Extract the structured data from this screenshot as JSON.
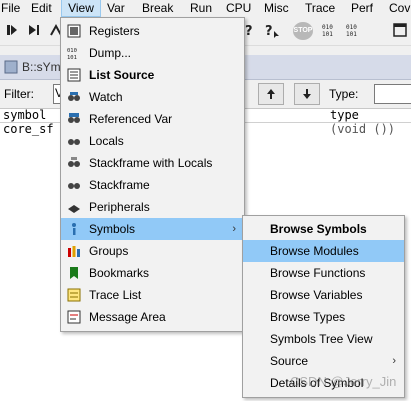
{
  "menubar": {
    "items": [
      "File",
      "Edit",
      "View",
      "Var",
      "Break",
      "Run",
      "CPU",
      "Misc",
      "Trace",
      "Perf",
      "Cov"
    ]
  },
  "toolbar": {
    "stop_label": "STOP"
  },
  "window": {
    "title": "B::sYm",
    "filter_label": "Filter:",
    "filter_value": "V",
    "type_label": "Type:",
    "columns": [
      "symbol",
      "type"
    ],
    "rows": [
      {
        "symbol": "core_sf",
        "type": "(void ())"
      }
    ]
  },
  "view_menu": {
    "items": [
      {
        "label": "Registers",
        "icon": "registers-icon"
      },
      {
        "label": "Dump...",
        "icon": "dump-icon"
      },
      {
        "label": "List Source",
        "icon": "list-source-icon",
        "bold": true
      },
      {
        "label": "Watch",
        "icon": "watch-icon"
      },
      {
        "label": "Referenced Var",
        "icon": "referenced-var-icon"
      },
      {
        "label": "Locals",
        "icon": "locals-icon"
      },
      {
        "label": "Stackframe with Locals",
        "icon": "stackframe-locals-icon"
      },
      {
        "label": "Stackframe",
        "icon": "stackframe-icon"
      },
      {
        "label": "Peripherals",
        "icon": "peripherals-icon"
      },
      {
        "label": "Symbols",
        "icon": "symbols-icon",
        "submenu": true
      },
      {
        "label": "Groups",
        "icon": "groups-icon"
      },
      {
        "label": "Bookmarks",
        "icon": "bookmark-icon"
      },
      {
        "label": "Trace List",
        "icon": "trace-list-icon"
      },
      {
        "label": "Message Area",
        "icon": "message-area-icon"
      }
    ]
  },
  "symbols_menu": {
    "items": [
      {
        "label": "Browse Symbols",
        "bold": true
      },
      {
        "label": "Browse Modules"
      },
      {
        "label": "Browse Functions"
      },
      {
        "label": "Browse Variables"
      },
      {
        "label": "Browse Types"
      },
      {
        "label": "Symbols Tree View"
      },
      {
        "label": "Source",
        "submenu": true
      },
      {
        "label": "Details of Symbol"
      }
    ]
  },
  "watermark": "CSDN @Jerry_Jin"
}
